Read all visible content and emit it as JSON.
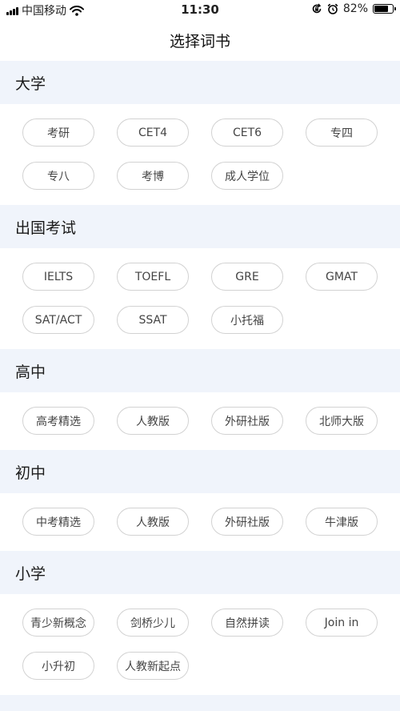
{
  "status_bar": {
    "carrier": "中国移动",
    "time": "11:30",
    "battery_percent": "82%",
    "battery_level": 0.82
  },
  "nav": {
    "title": "选择词书"
  },
  "sections": [
    {
      "title": "大学",
      "items": [
        "考研",
        "CET4",
        "CET6",
        "专四",
        "专八",
        "考博",
        "成人学位"
      ]
    },
    {
      "title": "出国考试",
      "items": [
        "IELTS",
        "TOEFL",
        "GRE",
        "GMAT",
        "SAT/ACT",
        "SSAT",
        "小托福"
      ]
    },
    {
      "title": "高中",
      "items": [
        "高考精选",
        "人教版",
        "外研社版",
        "北师大版"
      ]
    },
    {
      "title": "初中",
      "items": [
        "中考精选",
        "人教版",
        "外研社版",
        "牛津版"
      ]
    },
    {
      "title": "小学",
      "items": [
        "青少新概念",
        "剑桥少儿",
        "自然拼读",
        "Join in",
        "小升初",
        "人教新起点"
      ]
    }
  ],
  "colors": {
    "section_bg": "#f0f4fb",
    "chip_border": "#d2d2d2"
  },
  "icons": [
    "signal-icon",
    "wifi-icon",
    "orientation-lock-icon",
    "alarm-icon",
    "battery-icon"
  ]
}
